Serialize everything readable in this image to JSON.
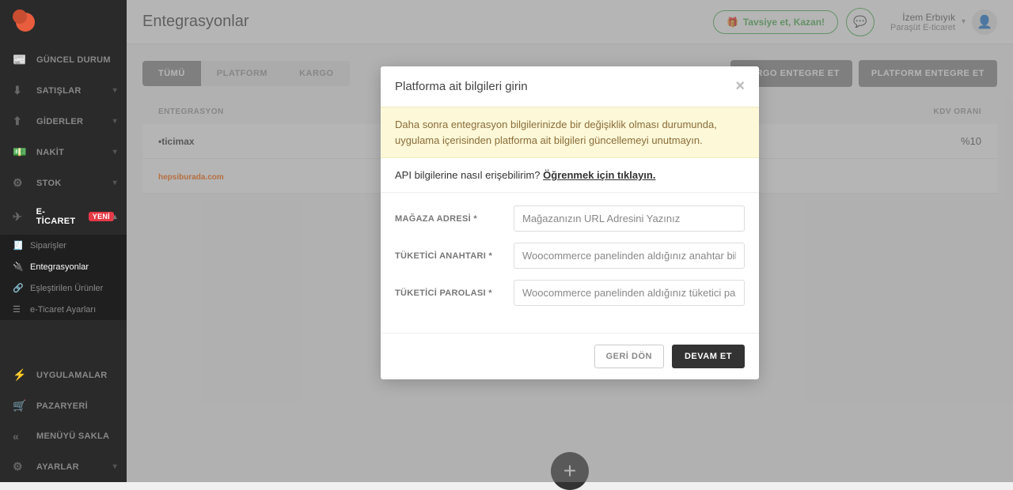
{
  "sidebar": {
    "items": [
      {
        "label": "GÜNCEL DURUM",
        "icon": "📰"
      },
      {
        "label": "SATIŞLAR",
        "icon": "⬇"
      },
      {
        "label": "GİDERLER",
        "icon": "⬆"
      },
      {
        "label": "NAKİT",
        "icon": "💵"
      },
      {
        "label": "STOK",
        "icon": "⚙"
      },
      {
        "label": "E-TİCARET",
        "icon": "✈",
        "badge": "YENİ"
      }
    ],
    "sub": [
      {
        "label": "Siparişler",
        "icon": "🧾"
      },
      {
        "label": "Entegrasyonlar",
        "icon": "🔌"
      },
      {
        "label": "Eşleştirilen Ürünler",
        "icon": "🔗"
      },
      {
        "label": "e-Ticaret Ayarları",
        "icon": "☰"
      }
    ],
    "bottom": [
      {
        "label": "UYGULAMALAR",
        "icon": "⚡"
      },
      {
        "label": "PAZARYERİ",
        "icon": "🛒"
      },
      {
        "label": "MENÜYÜ SAKLA",
        "icon": "«"
      },
      {
        "label": "AYARLAR",
        "icon": "⚙"
      }
    ]
  },
  "header": {
    "title": "Entegrasyonlar",
    "recommend": "Tavsiye et, Kazan!",
    "user_name": "İzem Erbıyık",
    "user_company": "Paraşüt E-ticaret"
  },
  "toolbar": {
    "tabs": [
      "TÜMÜ",
      "PLATFORM",
      "KARGO"
    ],
    "btn_cargo": "KARGO ENTEGRE ET",
    "btn_platform": "PLATFORM ENTEGRE ET"
  },
  "table": {
    "col_entegrasyon": "ENTEGRASYON",
    "col_kdv": "KDV ORANI",
    "rows": [
      {
        "logo": "ticimax",
        "kdv": "%10"
      },
      {
        "logo": "hepsiburada.com",
        "kdv": ""
      }
    ]
  },
  "modal": {
    "title": "Platforma ait bilgileri girin",
    "warn": "Daha sonra entegrasyon bilgilerinizde bir değişiklik olması durumunda, uygulama içerisinden platforma ait bilgileri güncellemeyi unutmayın.",
    "api_q": "API bilgilerine nasıl erişebilirim? ",
    "api_link": "Öğrenmek için tıklayın.",
    "fields": [
      {
        "label": "MAĞAZA ADRESİ *",
        "placeholder": "Mağazanızın URL Adresini Yazınız"
      },
      {
        "label": "TÜKETİCİ ANAHTARI *",
        "placeholder": "Woocommerce panelinden aldığınız anahtar bilgisi"
      },
      {
        "label": "TÜKETİCİ PAROLASI *",
        "placeholder": "Woocommerce panelinden aldığınız tüketici parola"
      }
    ],
    "btn_back": "GERİ DÖN",
    "btn_next": "DEVAM ET"
  }
}
